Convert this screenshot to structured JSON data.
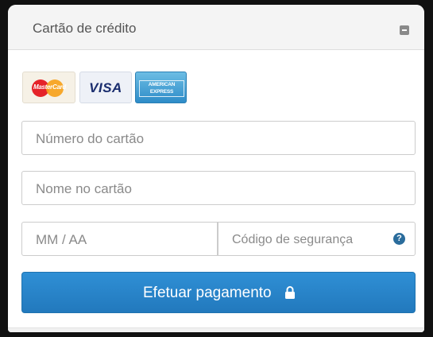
{
  "panel": {
    "title": "Cartão de crédito",
    "collapse_icon": "minus-square-icon"
  },
  "card_logos": {
    "mastercard": "MasterCard",
    "visa": "VISA",
    "amex_line1": "AMERICAN",
    "amex_line2": "EXPRESS"
  },
  "form": {
    "card_number_placeholder": "Número do cartão",
    "card_name_placeholder": "Nome no cartão",
    "expiry_placeholder": "MM / AA",
    "cvv_placeholder": "Código de segurança",
    "help_icon": "question-circle-icon"
  },
  "submit": {
    "label": "Efetuar pagamento",
    "icon": "lock-icon"
  },
  "colors": {
    "button": "#2a83c8",
    "help_icon": "#2a6c9c",
    "background": "#111111"
  }
}
